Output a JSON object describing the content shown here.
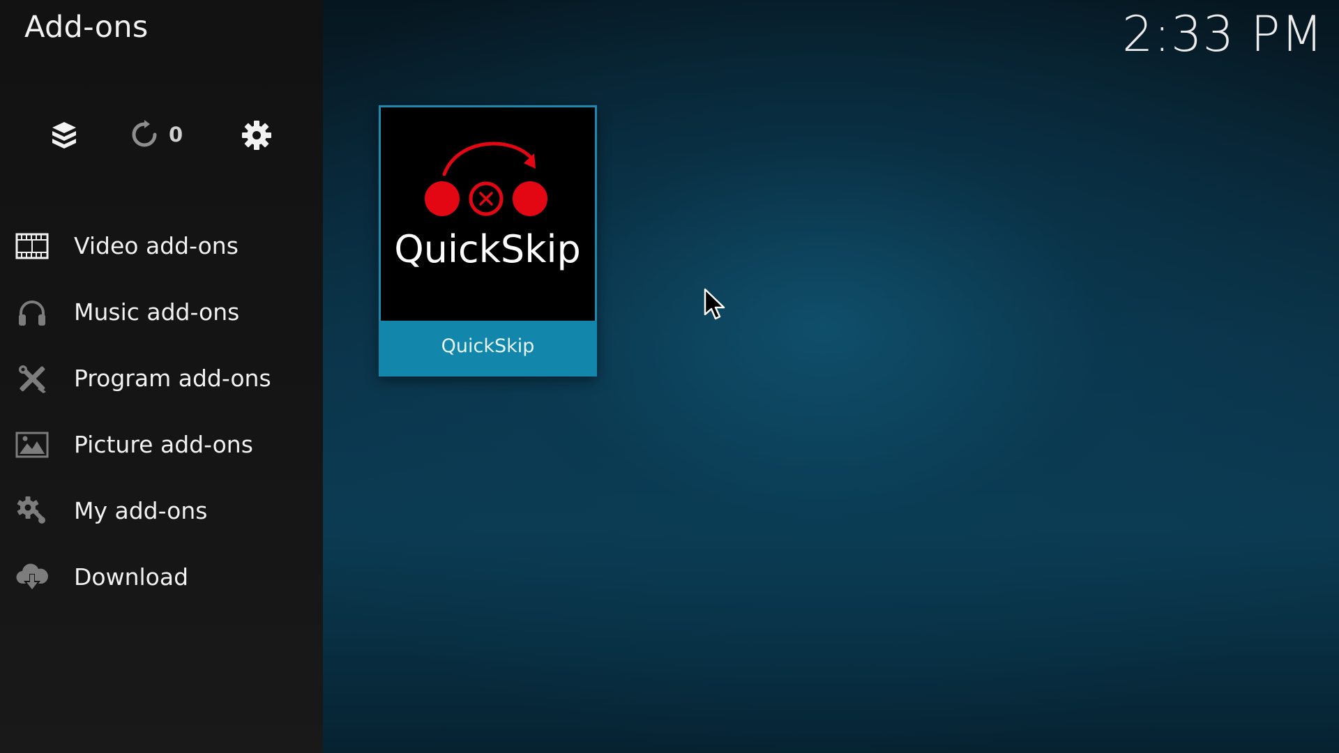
{
  "window": {
    "title": "Add-ons",
    "clock": "2:33 PM"
  },
  "toolbar": {
    "addon_browser_icon": "open-box-icon",
    "updates_icon": "refresh-icon",
    "updates_count": "0",
    "settings_icon": "gear-icon"
  },
  "sidebar": {
    "items": [
      {
        "label": "Video add-ons",
        "icon": "film-strip-icon"
      },
      {
        "label": "Music add-ons",
        "icon": "headphones-icon"
      },
      {
        "label": "Program add-ons",
        "icon": "tools-icon"
      },
      {
        "label": "Picture add-ons",
        "icon": "picture-icon"
      },
      {
        "label": "My add-ons",
        "icon": "gears-icon"
      },
      {
        "label": "Download",
        "icon": "cloud-download-icon"
      }
    ]
  },
  "content": {
    "addons": [
      {
        "name": "QuickSkip",
        "logo_text": "QuickSkip",
        "logo_color": "#e30613",
        "selected": true
      }
    ]
  },
  "colors": {
    "accent": "#1286ab",
    "sidebar_bg": "#141414",
    "logo_red": "#e30613"
  }
}
